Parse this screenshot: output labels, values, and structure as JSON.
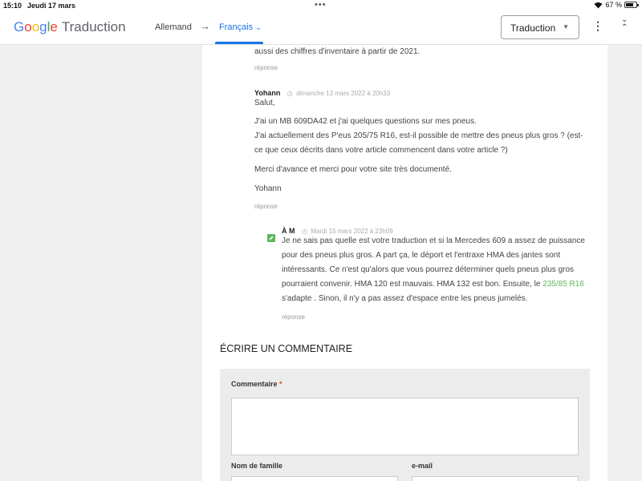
{
  "status_bar": {
    "time": "15:10",
    "date": "Jeudi 17 mars",
    "battery": "67 %",
    "battery_level": 0.67
  },
  "header": {
    "logo_word": "Google",
    "logo_suffix": "Traduction",
    "source_lang": "Allemand",
    "arrow": "→",
    "target_lang": "Français",
    "mode_label": "Traduction",
    "menu_icon": "more-vert-icon",
    "collapse_icon": "collapse-icon"
  },
  "comments": {
    "prev_tail": "aussi des chiffres d'inventaire à partir de 2021.",
    "prev_reply": "réponse",
    "c1": {
      "author": "Yohann",
      "date": "dimanche 13 mars 2022 à 20h33",
      "p1": "Salut,",
      "p2a": "J'ai un MB 609DA42 et j'ai quelques questions sur mes pneus.",
      "p2b": "J'ai actuellement des P'eus 205/75 R16, est-il possible de mettre des pneus plus gros ? (est-ce que ceux décrits dans votre article commencent dans votre article ?)",
      "p3": "Merci d'avance et merci pour votre site très documenté.",
      "p4": "Yohann",
      "reply": "réponse"
    },
    "c2": {
      "author": "À M",
      "date": "Mardi 15 mars 2022 à 23h09",
      "text_a": "Je ne sais pas quelle est votre traduction et si la Mercedes 609 a assez de puissance pour des pneus plus gros. A part ça, le déport et l'entraxe HMA des jantes sont intéressants. Ce n'est qu'alors que vous pourrez déterminer quels pneus plus gros pourraient convenir. HMA 120 est mauvais. HMA 132 est bon. Ensuite, le ",
      "link": "235/85 R16",
      "text_b": " s'adapte . Sinon, il n'y a pas assez d'espace entre les pneus jumelés.",
      "reply": "réponse"
    }
  },
  "form": {
    "heading": "ÉCRIRE UN COMMENTAIRE",
    "comment_label": "Commentaire",
    "required_mark": "*",
    "lastname_label": "Nom de famille",
    "email_label": "e-mail"
  },
  "colors": {
    "accent_blue": "#1a73e8",
    "link_green": "#5cb85c",
    "required": "#e64a19"
  }
}
